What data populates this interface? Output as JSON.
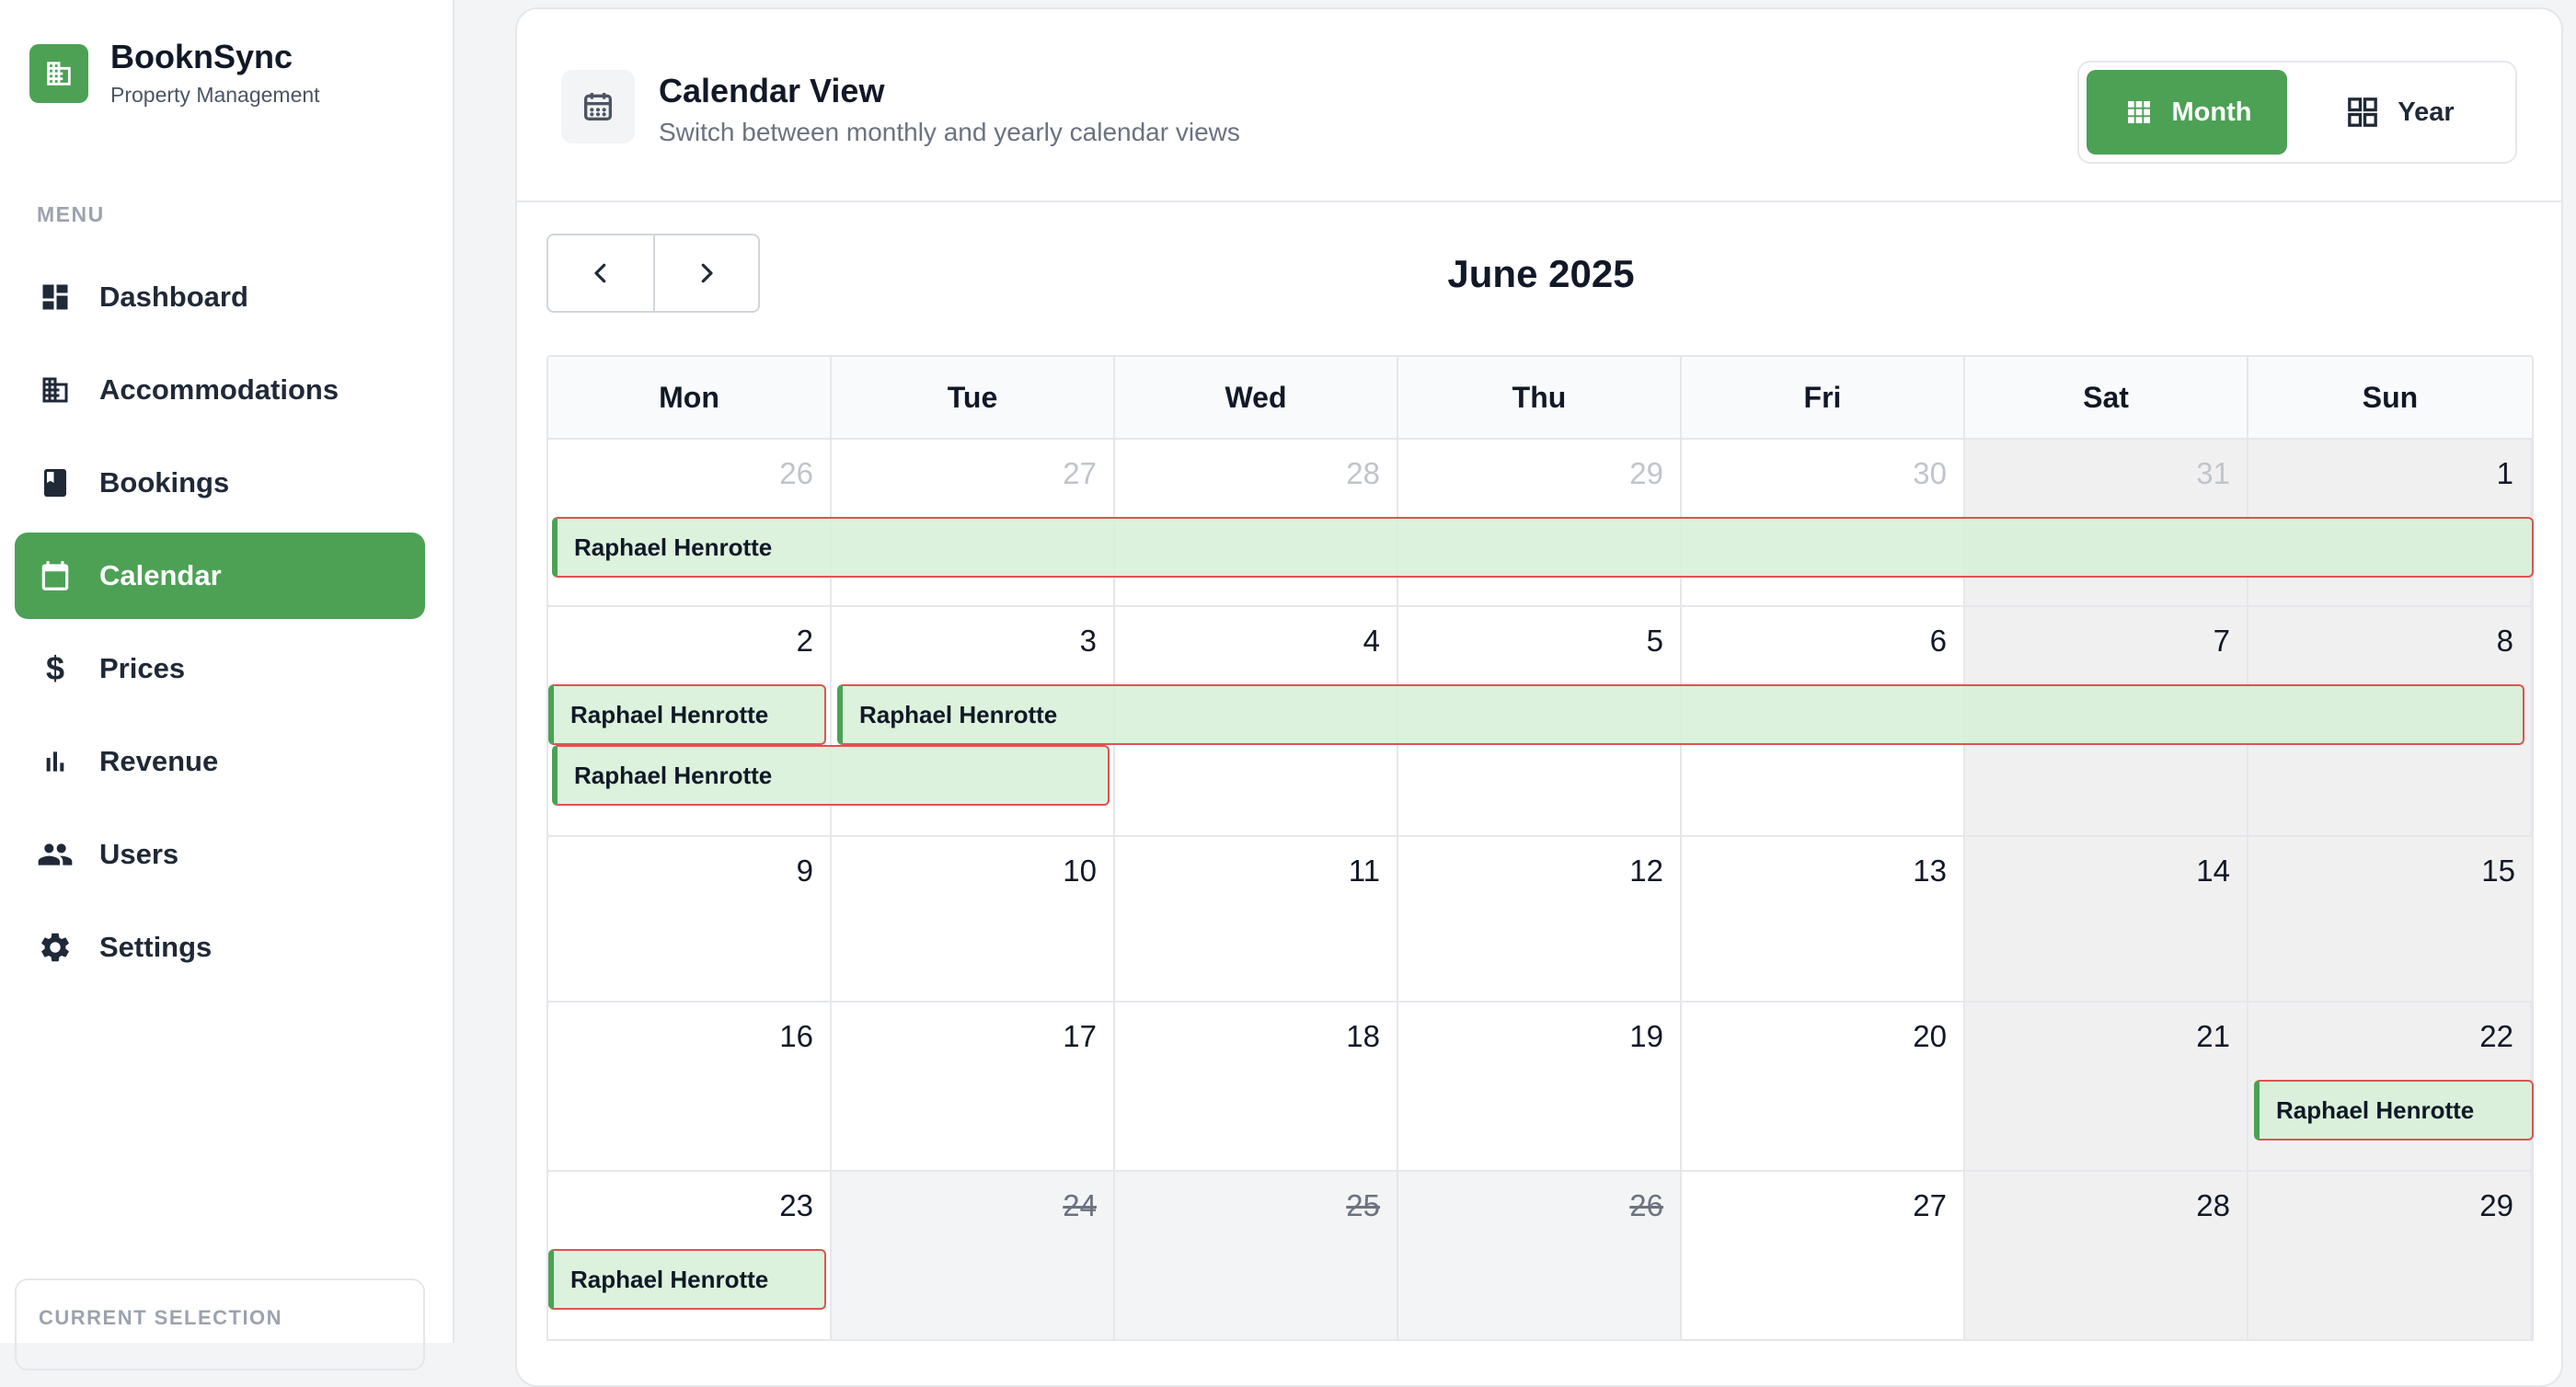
{
  "brand": {
    "name": "BooknSync",
    "subtitle": "Property Management",
    "icon": "building-icon",
    "accent": "#4ca155"
  },
  "sidebar": {
    "menu_label": "MENU",
    "items": [
      {
        "label": "Dashboard",
        "icon": "dashboard-icon",
        "active": false
      },
      {
        "label": "Accommodations",
        "icon": "building-icon",
        "active": false
      },
      {
        "label": "Bookings",
        "icon": "book-icon",
        "active": false
      },
      {
        "label": "Calendar",
        "icon": "calendar-icon",
        "active": true
      },
      {
        "label": "Prices",
        "icon": "dollar-icon",
        "active": false
      },
      {
        "label": "Revenue",
        "icon": "bar-chart-icon",
        "active": false
      },
      {
        "label": "Users",
        "icon": "users-icon",
        "active": false
      },
      {
        "label": "Settings",
        "icon": "gear-icon",
        "active": false
      }
    ],
    "current_selection_label": "CURRENT SELECTION"
  },
  "header": {
    "title": "Calendar View",
    "subtitle": "Switch between monthly and yearly calendar views",
    "view_toggle": {
      "month": "Month",
      "year": "Year",
      "selected": "Month"
    }
  },
  "calendar": {
    "month_title": "June 2025",
    "weekdays": [
      "Mon",
      "Tue",
      "Wed",
      "Thu",
      "Fri",
      "Sat",
      "Sun"
    ],
    "weeks": [
      [
        "26",
        "27",
        "28",
        "29",
        "30",
        "31",
        "1"
      ],
      [
        "2",
        "3",
        "4",
        "5",
        "6",
        "7",
        "8"
      ],
      [
        "9",
        "10",
        "11",
        "12",
        "13",
        "14",
        "15"
      ],
      [
        "16",
        "17",
        "18",
        "19",
        "20",
        "21",
        "22"
      ],
      [
        "23",
        "24",
        "25",
        "26",
        "27",
        "28",
        "29"
      ]
    ],
    "other_month_days": [
      "26",
      "27",
      "28",
      "29",
      "30",
      "31"
    ],
    "blocked_days": [
      "24",
      "25",
      "26"
    ],
    "bookings": [
      {
        "guest": "Raphael Henrotte",
        "start": "2025-05-26",
        "end": "2025-06-01"
      },
      {
        "guest": "Raphael Henrotte",
        "start": "2025-06-02",
        "end": "2025-06-02"
      },
      {
        "guest": "Raphael Henrotte",
        "start": "2025-06-03",
        "end": "2025-06-08"
      },
      {
        "guest": "Raphael Henrotte",
        "start": "2025-06-02",
        "end": "2025-06-03"
      },
      {
        "guest": "Raphael Henrotte",
        "start": "2025-06-22",
        "end": "2025-06-22"
      },
      {
        "guest": "Raphael Henrotte",
        "start": "2025-06-23",
        "end": "2025-06-23"
      }
    ]
  }
}
